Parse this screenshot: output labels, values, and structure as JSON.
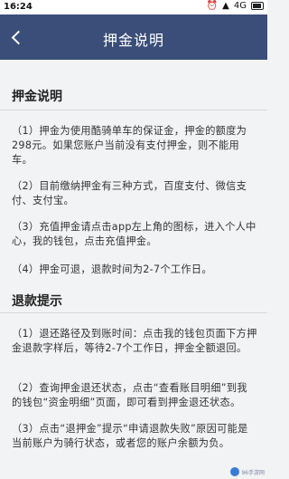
{
  "status_bar": {
    "time": "16:24",
    "signal_text": "4G"
  },
  "nav": {
    "title": "押金说明"
  },
  "deposit": {
    "title": "押金说明",
    "items": [
      "（1）押金为使用酷骑单车的保证金，押金的额度为298元。如果您账户当前没有支付押金，则不能用车。",
      "（2）目前缴纳押金有三种方式，百度支付、微信支付、支付宝。",
      "（3）充值押金请点击app左上角的图标，进入个人中心，我的钱包，点击充值押金。",
      "（4）押金可退，退款时间为2-7个工作日。"
    ]
  },
  "refund": {
    "title": "退款提示",
    "items": [
      "（1）退还路径及到账时间：点击我的钱包页面下方押金退款字样后，等待2-7个工作日，押金全额退回。",
      "（2）查询押金退还状态，点击“查看账目明细”到我的钱包“资金明细”页面，即可看到押金退还状态。",
      "（3）点击“退押金”提示“申请退款失败”原因可能是当前账户为骑行状态，或者您的账户余额为负。"
    ]
  },
  "watermark": {
    "text": "96手游网"
  }
}
